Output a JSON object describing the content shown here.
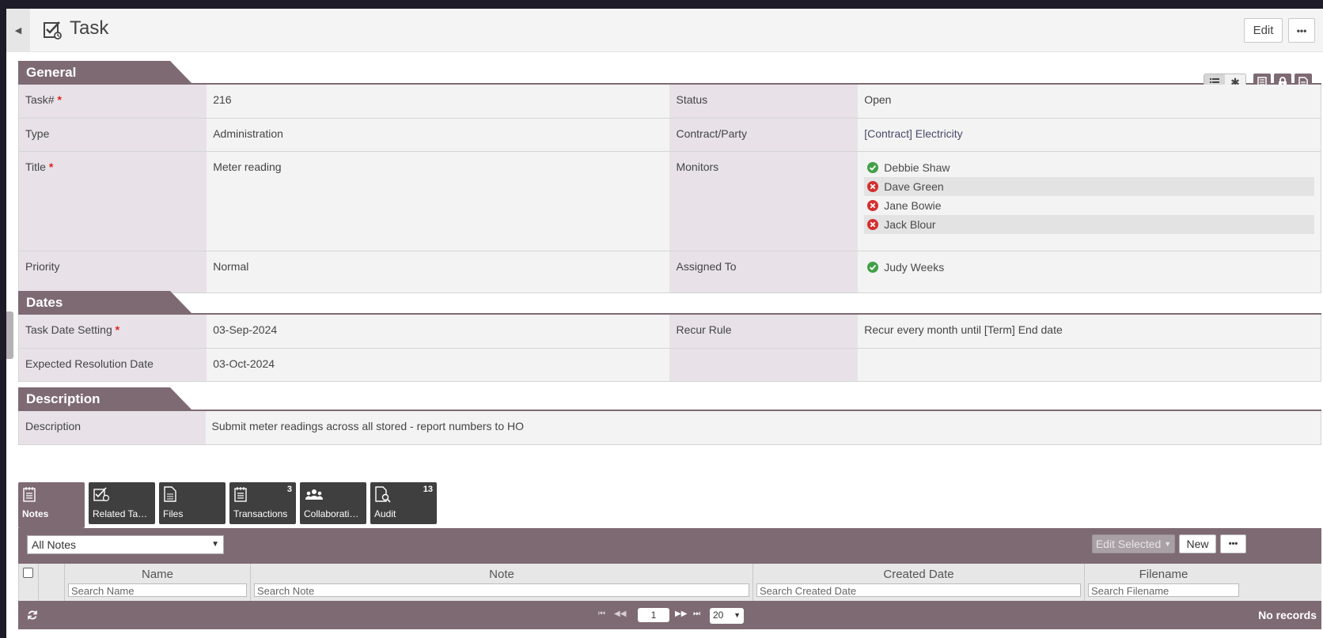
{
  "header": {
    "title": "Task",
    "edit_label": "Edit",
    "more_label": "•••"
  },
  "colors": {
    "accent": "#7e6a73",
    "label_bg": "#e8e2e8",
    "ok": "#43a047",
    "remove": "#d32f2f"
  },
  "sections": {
    "general": "General",
    "dates": "Dates",
    "description": "Description"
  },
  "general": {
    "task_no_label": "Task#",
    "task_no_value": "216",
    "status_label": "Status",
    "status_value": "Open",
    "type_label": "Type",
    "type_value": "Administration",
    "contract_label": "Contract/Party",
    "contract_value": "[Contract] Electricity",
    "title_label": "Title",
    "title_value": "Meter reading",
    "monitors_label": "Monitors",
    "monitors": [
      {
        "name": "Debbie Shaw",
        "icon": "check-icon"
      },
      {
        "name": "Dave Green",
        "icon": "remove-icon"
      },
      {
        "name": "Jane Bowie",
        "icon": "remove-icon"
      },
      {
        "name": "Jack Blour",
        "icon": "remove-icon"
      }
    ],
    "priority_label": "Priority",
    "priority_value": "Normal",
    "assigned_label": "Assigned To",
    "assigned_value": "Judy Weeks"
  },
  "dates": {
    "setting_label": "Task Date Setting",
    "setting_value": "03-Sep-2024",
    "recur_label": "Recur Rule",
    "recur_value": "Recur every month until [Term] End date",
    "expected_label": "Expected Resolution Date",
    "expected_value": "03-Oct-2024"
  },
  "description": {
    "label": "Description",
    "value": "Submit meter readings across all stored - report numbers to HO"
  },
  "tabs": [
    {
      "label": "Notes",
      "count": ""
    },
    {
      "label": "Related Tasks",
      "count": ""
    },
    {
      "label": "Files",
      "count": ""
    },
    {
      "label": "Transactions",
      "count": "3"
    },
    {
      "label": "Collaborations",
      "count": ""
    },
    {
      "label": "Audit",
      "count": "13"
    }
  ],
  "grid": {
    "filter_value": "All Notes",
    "edit_selected_label": "Edit Selected",
    "new_label": "New",
    "more_label": "•••",
    "columns": [
      {
        "title": "Name",
        "placeholder": "Search Name"
      },
      {
        "title": "Note",
        "placeholder": "Search Note"
      },
      {
        "title": "Created Date",
        "placeholder": "Search Created Date"
      },
      {
        "title": "Filename",
        "placeholder": "Search Filename"
      }
    ],
    "page": "1",
    "page_size": "20",
    "no_records": "No records"
  }
}
